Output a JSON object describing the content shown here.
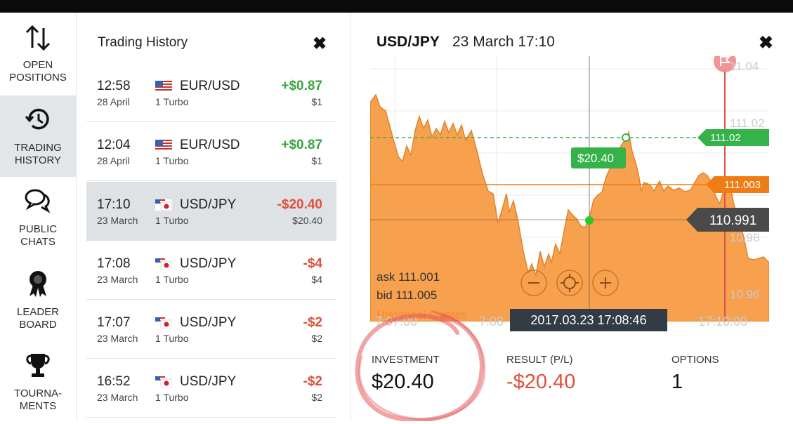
{
  "nav": {
    "items": [
      {
        "label": "OPEN\nPOSITIONS",
        "icon": "arrows-up-down-icon"
      },
      {
        "label": "TRADING\nHISTORY",
        "icon": "history-clock-icon",
        "active": true
      },
      {
        "label": "PUBLIC\nCHATS",
        "icon": "chat-bubbles-icon"
      },
      {
        "label": "LEADER\nBOARD",
        "icon": "medal-icon"
      },
      {
        "label": "TOURNA-\nMENTS",
        "icon": "trophy-icon"
      }
    ]
  },
  "history": {
    "title": "Trading History",
    "close_icon": "close-icon",
    "rows": [
      {
        "time": "12:58",
        "date": "28 April",
        "pair": "EUR/USD",
        "type": "1 Turbo",
        "result": "+$0.87",
        "investment": "$1",
        "positive": true,
        "flag": "us-flag-icon"
      },
      {
        "time": "12:04",
        "date": "28 April",
        "pair": "EUR/USD",
        "type": "1 Turbo",
        "result": "+$0.87",
        "investment": "$1",
        "positive": true,
        "flag": "us-flag-icon"
      },
      {
        "time": "17:10",
        "date": "23 March",
        "pair": "USD/JPY",
        "type": "1 Turbo",
        "result": "-$20.40",
        "investment": "$20.40",
        "positive": false,
        "flag": "us-jp-flag-icon",
        "active": true
      },
      {
        "time": "17:08",
        "date": "23 March",
        "pair": "USD/JPY",
        "type": "1 Turbo",
        "result": "-$4",
        "investment": "$4",
        "positive": false,
        "flag": "us-jp-flag-icon"
      },
      {
        "time": "17:07",
        "date": "23 March",
        "pair": "USD/JPY",
        "type": "1 Turbo",
        "result": "-$2",
        "investment": "$2",
        "positive": false,
        "flag": "us-jp-flag-icon"
      },
      {
        "time": "16:52",
        "date": "23 March",
        "pair": "USD/JPY",
        "type": "1 Turbo",
        "result": "-$2",
        "investment": "$2",
        "positive": false,
        "flag": "us-jp-flag-icon"
      }
    ]
  },
  "detail": {
    "pair": "USD/JPY",
    "datetime": "23 March 17:10",
    "chart": {
      "price_ticks": [
        "11.04",
        "111.02",
        "10.98",
        "10.96"
      ],
      "tag_upper": "111.02",
      "tag_mid": "111.003",
      "tag_current": "110.991",
      "bubble": "$20.40",
      "ask_label": "ask 111.001",
      "bid_label": "bid 111.005",
      "historical_label": "Historical Quotes",
      "time_ticks": [
        "7:07:00",
        "7:08",
        "17:10:00"
      ],
      "cursor_time": "2017.03.23 17:08:46",
      "colors": {
        "area": "#f7a04e",
        "green": "#36b24a",
        "orange": "#f07d14",
        "dark_tag": "#4a4a4a"
      },
      "controls": [
        "zoom-out-icon",
        "crosshair-icon",
        "zoom-in-icon"
      ]
    },
    "stats": {
      "investment_label": "INVESTMENT",
      "investment_value": "$20.40",
      "result_label": "RESULT (P/L)",
      "result_value": "-$20.40",
      "options_label": "OPTIONS",
      "options_value": "1"
    }
  },
  "colors": {
    "positive": "#3aa53f",
    "negative": "#e0503a",
    "highlight_circle": "#e45a5a"
  }
}
